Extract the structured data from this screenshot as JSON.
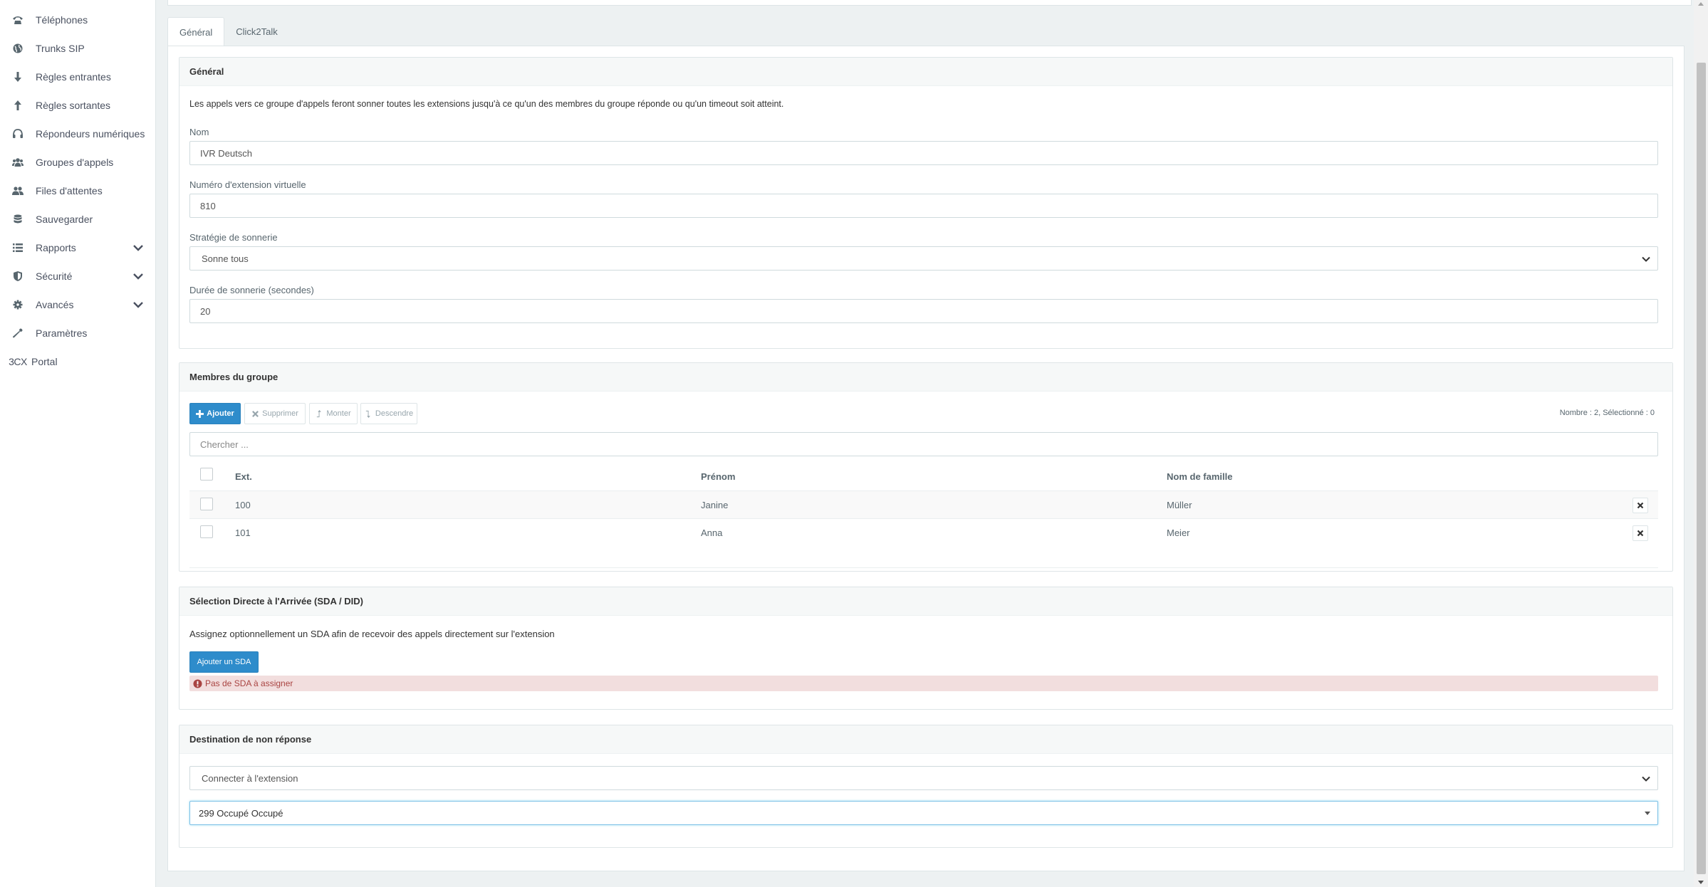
{
  "sidebar": {
    "items": [
      {
        "label": "Téléphones",
        "icon": "phone-icon"
      },
      {
        "label": "Trunks SIP",
        "icon": "globe-icon"
      },
      {
        "label": "Règles entrantes",
        "icon": "arrow-down-icon"
      },
      {
        "label": "Règles sortantes",
        "icon": "arrow-up-icon"
      },
      {
        "label": "Répondeurs numériques",
        "icon": "headset-icon"
      },
      {
        "label": "Groupes d'appels",
        "icon": "users-icon"
      },
      {
        "label": "Files d'attentes",
        "icon": "user-group-icon"
      },
      {
        "label": "Sauvegarder",
        "icon": "database-icon"
      },
      {
        "label": "Rapports",
        "icon": "list-icon",
        "expandable": true
      },
      {
        "label": "Sécurité",
        "icon": "shield-icon",
        "expandable": true
      },
      {
        "label": "Avancés",
        "icon": "gear-icon",
        "expandable": true
      },
      {
        "label": "Paramètres",
        "icon": "wrench-icon"
      },
      {
        "label": "Portal",
        "icon_text": "3CX"
      }
    ]
  },
  "tabs": [
    {
      "label": "Général",
      "active": true
    },
    {
      "label": "Click2Talk",
      "active": false
    }
  ],
  "general": {
    "heading": "Général",
    "description": "Les appels vers ce groupe d'appels feront sonner toutes les extensions jusqu'à ce qu'un des membres du groupe réponde ou qu'un timeout soit atteint.",
    "name_label": "Nom",
    "name_value": "IVR Deutsch",
    "ext_label": "Numéro d'extension virtuelle",
    "ext_value": "810",
    "strategy_label": "Stratégie de sonnerie",
    "strategy_value": "Sonne tous",
    "duration_label": "Durée de sonnerie (secondes)",
    "duration_value": "20"
  },
  "members": {
    "heading": "Membres du groupe",
    "add_label": "Ajouter",
    "delete_label": "Supprimer",
    "up_label": "Monter",
    "down_label": "Descendre",
    "count_text": "Nombre : 2, Sélectionné : 0",
    "search_placeholder": "Chercher ...",
    "columns": {
      "ext": "Ext.",
      "first": "Prénom",
      "last": "Nom de famille"
    },
    "rows": [
      {
        "ext": "100",
        "first": "Janine",
        "last": "Müller"
      },
      {
        "ext": "101",
        "first": "Anna",
        "last": "Meier"
      }
    ]
  },
  "sda": {
    "heading": "Sélection Directe à l'Arrivée (SDA / DID)",
    "description": "Assignez optionnellement un SDA afin de recevoir des appels directement sur l'extension",
    "add_label": "Ajouter un SDA",
    "alert_text": "Pas de SDA à assigner"
  },
  "noanswer": {
    "heading": "Destination de non réponse",
    "action_value": "Connecter à l'extension",
    "target_value": "299 Occupé Occupé"
  },
  "colors": {
    "primary": "#2e8ccb",
    "alert_bg": "#f2dede",
    "alert_text": "#a94442"
  }
}
